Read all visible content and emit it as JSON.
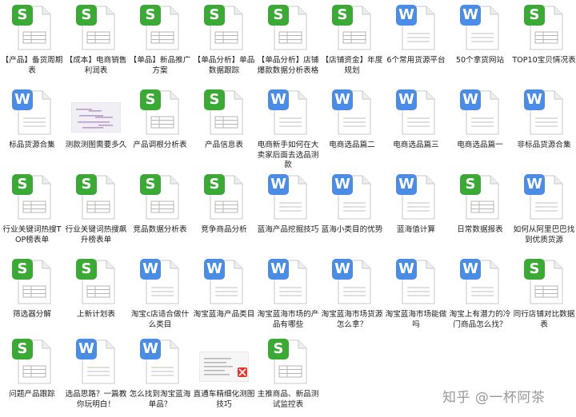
{
  "files": [
    {
      "label": "【产品】备货周期表",
      "type": "S"
    },
    {
      "label": "【成本】电商销售利润表",
      "type": "S"
    },
    {
      "label": "【单品】新品推广方案",
      "type": "S"
    },
    {
      "label": "【单品分析】单品数据跟踪",
      "type": "S"
    },
    {
      "label": "【单品分析】店铺爆款数据分析表格",
      "type": "S"
    },
    {
      "label": "【店铺资金】年度规划",
      "type": "S"
    },
    {
      "label": "6个常用货源平台",
      "type": "W"
    },
    {
      "label": "50个拿货网站",
      "type": "W"
    },
    {
      "label": "TOP10宝贝情况表",
      "type": "S"
    },
    {
      "label": "标品货源合集",
      "type": "W"
    },
    {
      "label": "测款测图需要多久",
      "type": "thumb"
    },
    {
      "label": "产品调根分析表",
      "type": "S"
    },
    {
      "label": "产品信息表",
      "type": "S"
    },
    {
      "label": "电商新手如何在大卖家后面去选品测款",
      "type": "W"
    },
    {
      "label": "电商选品篇二",
      "type": "W"
    },
    {
      "label": "电商选品篇三",
      "type": "W"
    },
    {
      "label": "电商选品篇一",
      "type": "W"
    },
    {
      "label": "非标品货源合集",
      "type": "W"
    },
    {
      "label": "行业关键词热搜TOP榜表单",
      "type": "S"
    },
    {
      "label": "行业关键词热搜飙升榜表单",
      "type": "S"
    },
    {
      "label": "竞品数据分析表",
      "type": "S"
    },
    {
      "label": "竞争商品分析",
      "type": "S"
    },
    {
      "label": "蓝海产品挖掘技巧",
      "type": "W"
    },
    {
      "label": "蓝海小类目的优势",
      "type": "W"
    },
    {
      "label": "蓝海值计算",
      "type": "W"
    },
    {
      "label": "日常数据报表",
      "type": "S"
    },
    {
      "label": "如何从阿里巴巴找到优质货源",
      "type": "W"
    },
    {
      "label": "筛选器分解",
      "type": "S"
    },
    {
      "label": "上新计划表",
      "type": "S"
    },
    {
      "label": "淘宝c店适合做什么类目",
      "type": "W"
    },
    {
      "label": "淘宝蓝海产品类目",
      "type": "W"
    },
    {
      "label": "淘宝蓝海市场的产品有哪些",
      "type": "W"
    },
    {
      "label": "淘宝蓝海市场货源怎么拿？",
      "type": "W"
    },
    {
      "label": "淘宝蓝海市场能做吗",
      "type": "W"
    },
    {
      "label": "淘宝上有潜力的冷门商品怎么找？",
      "type": "W"
    },
    {
      "label": "同行店铺对比数据表",
      "type": "S"
    },
    {
      "label": "问题产品跟踪",
      "type": "S"
    },
    {
      "label": "选品思路？一篇教你玩明白！",
      "type": "W"
    },
    {
      "label": "怎么找到淘宝蓝海单品？",
      "type": "W"
    },
    {
      "label": "直通车精细化测图技巧",
      "type": "thumb2"
    },
    {
      "label": "主推商品、新品测试监控表",
      "type": "S"
    }
  ],
  "watermark": "知乎 @一杯阿茶",
  "colors": {
    "sheet": "#3aaa35",
    "doc": "#4a8de6"
  }
}
